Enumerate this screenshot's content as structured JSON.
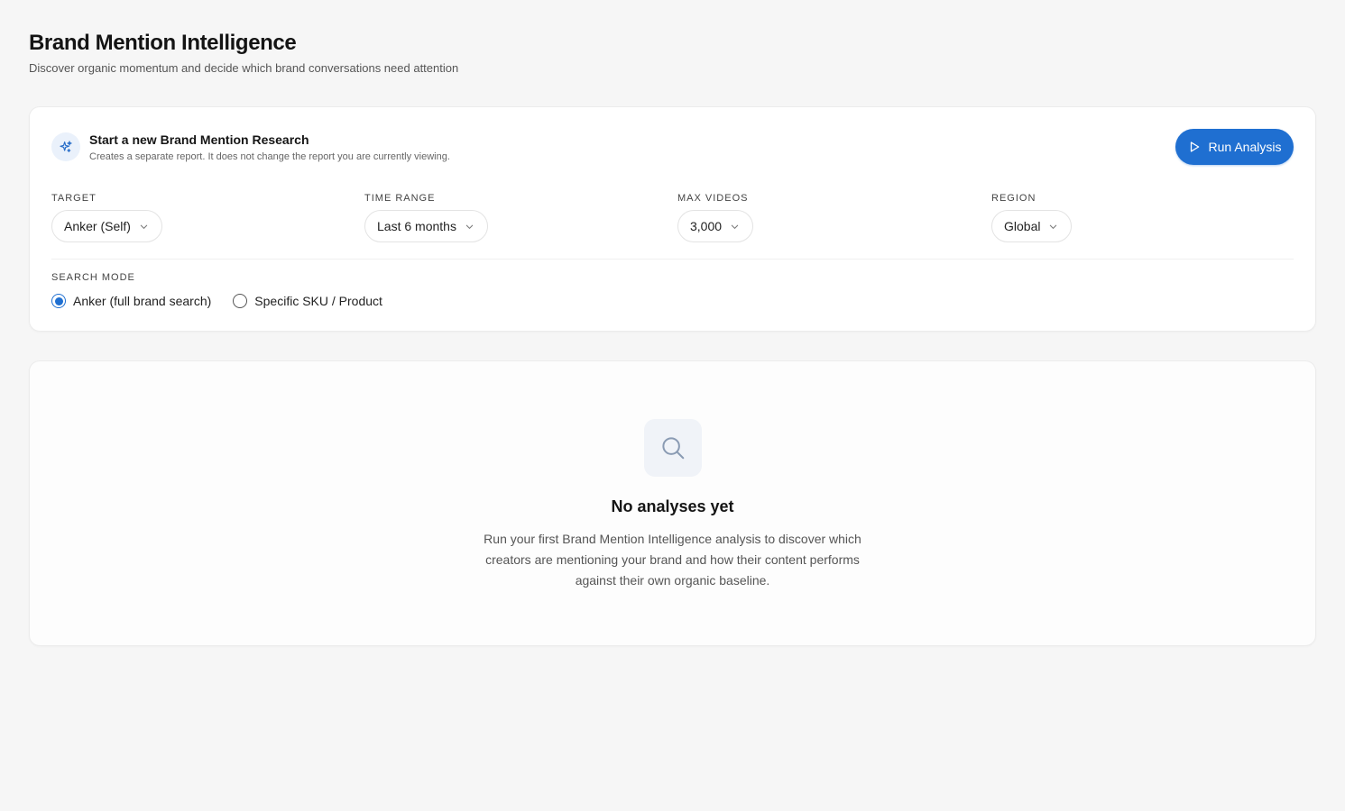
{
  "header": {
    "title": "Brand Mention Intelligence",
    "subtitle": "Discover organic momentum and decide which brand conversations need attention"
  },
  "research": {
    "title": "Start a new Brand Mention Research",
    "description": "Creates a separate report. It does not change the report you are currently viewing.",
    "run_label": "Run Analysis"
  },
  "filters": {
    "target": {
      "label": "TARGET",
      "value": "Anker (Self)"
    },
    "time_range": {
      "label": "TIME RANGE",
      "value": "Last 6 months"
    },
    "max_videos": {
      "label": "MAX VIDEOS",
      "value": "3,000"
    },
    "region": {
      "label": "REGION",
      "value": "Global"
    }
  },
  "search_mode": {
    "label": "SEARCH MODE",
    "options": [
      {
        "label": "Anker (full brand search)",
        "selected": true
      },
      {
        "label": "Specific SKU / Product",
        "selected": false
      }
    ]
  },
  "empty_state": {
    "title": "No analyses yet",
    "description": "Run your first Brand Mention Intelligence analysis to discover which creators are mentioning your brand and how their content performs against their own organic baseline."
  },
  "colors": {
    "accent": "#1f6fd1",
    "background": "#f6f6f6",
    "card": "#ffffff"
  },
  "icons": {
    "research": "sparkles-icon",
    "run": "play-icon",
    "dropdown": "chevron-down-icon",
    "empty": "search-icon"
  }
}
